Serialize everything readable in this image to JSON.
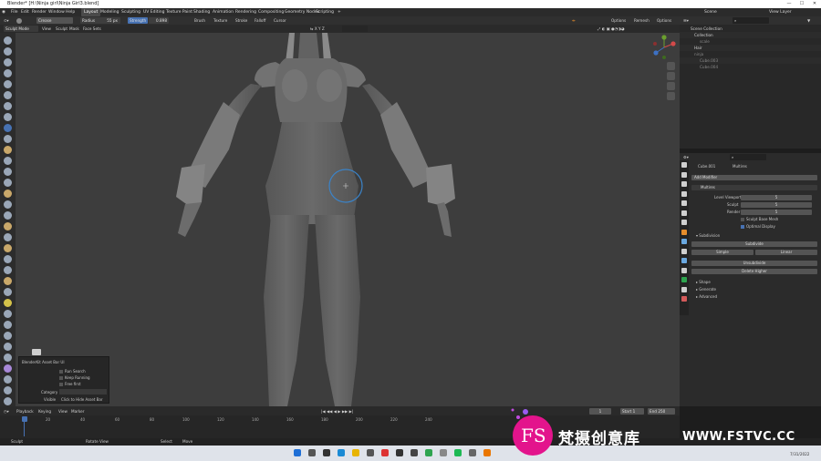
{
  "window": {
    "title": "Blender* [H:\\Ninja girl\\Ninja Girl3.blend]",
    "controls": [
      "—",
      "☐",
      "✕"
    ]
  },
  "menubar": {
    "items": [
      "File",
      "Edit",
      "Render",
      "Window",
      "Help"
    ],
    "workspaces": [
      "Layout",
      "Modeling",
      "Sculpting",
      "UV Editing",
      "Texture Paint",
      "Shading",
      "Animation",
      "Rendering",
      "Compositing",
      "Geometry Nodes",
      "Scripting",
      "+"
    ],
    "active_workspace": "Layout",
    "scene_label": "Scene",
    "view_layer_label": "View Layer"
  },
  "tool_header": {
    "brush_name": "Crease",
    "radius_label": "Radius",
    "radius_value": "55 px",
    "strength_label": "Strength",
    "strength_value": "0.898",
    "menus": [
      "Brush",
      "Texture",
      "Stroke",
      "Falloff",
      "Cursor"
    ],
    "right_items": [
      "Options",
      "Remesh",
      "Options"
    ]
  },
  "mode_header": {
    "mode": "Sculpt Mode",
    "menus": [
      "View",
      "Sculpt",
      "Mask",
      "Face Sets"
    ]
  },
  "asset_panel": {
    "title": "BlenderKit Asset Bar UI",
    "options": [
      "Run Search",
      "Keep Running",
      "Free first"
    ],
    "category_label": "Category",
    "visible_label": "Visible",
    "visible_value": "Click to Hide Asset Bar"
  },
  "outliner": {
    "search_placeholder": "",
    "rows": [
      {
        "name": "Scene Collection"
      },
      {
        "name": "Collection"
      },
      {
        "name": "scale"
      },
      {
        "name": "Hair"
      },
      {
        "name": "ninja"
      },
      {
        "name": "Cube.003"
      },
      {
        "name": "Cube.004"
      }
    ]
  },
  "properties": {
    "object_name": "Cube.001",
    "tab_label": "Multires",
    "add_modifier_label": "Add Modifier",
    "modifier_name": "Multires",
    "fields": [
      {
        "label": "Level Viewport",
        "value": "5"
      },
      {
        "label": "Sculpt",
        "value": "5"
      },
      {
        "label": "Render",
        "value": "5"
      }
    ],
    "checkbox_sculpt_base": "Sculpt Base Mesh",
    "checkbox_optimal": "Optimal Display",
    "subdivision_label": "Subdivision",
    "btn_subdivide": "Subdivide",
    "btn_simple": "Simple",
    "btn_linear": "Linear",
    "btn_unsubdivide": "Unsubdivide",
    "btn_delete_higher": "Delete Higher",
    "sections": [
      "Shape",
      "Generate",
      "Advanced"
    ]
  },
  "timeline": {
    "menus": [
      "Playback",
      "Keying",
      "View",
      "Marker"
    ],
    "current_frame": "1",
    "start_label": "Start",
    "start_value": "1",
    "end_label": "End",
    "end_value": "250",
    "ticks": [
      "0",
      "20",
      "40",
      "60",
      "80",
      "100",
      "120",
      "140",
      "160",
      "180",
      "200",
      "220",
      "240"
    ]
  },
  "status_bar": {
    "items": [
      "Sculpt",
      "Rotate View",
      "Select",
      "Move"
    ]
  },
  "taskbar": {
    "clock": "7/31/2022"
  },
  "watermark": {
    "logo_text": "FS",
    "cn_text": "梵摄创意库",
    "url_text": "WWW.FSTVC.CC"
  },
  "colors": {
    "accent_blue": "#4772b3",
    "viewport_bg": "#3d3d3d",
    "brush_circle": "#3b83c8",
    "watermark_pink": "#e3148c"
  }
}
